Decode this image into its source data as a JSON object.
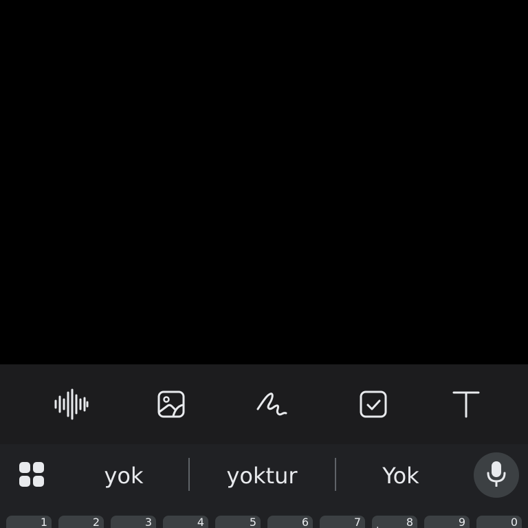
{
  "toolbar": {
    "tools": [
      {
        "name": "voice-recording-icon"
      },
      {
        "name": "image-icon"
      },
      {
        "name": "drawing-icon"
      },
      {
        "name": "checklist-icon"
      },
      {
        "name": "text-format-icon"
      }
    ]
  },
  "keyboard": {
    "suggestions": [
      "yok",
      "yoktur",
      "Yok"
    ],
    "apps_icon": "grid-apps-icon",
    "mic_icon": "microphone-icon",
    "number_keys": [
      "1",
      "2",
      "3",
      "4",
      "5",
      "6",
      "7",
      "8",
      "9",
      "0"
    ],
    "partial_key_mark": "."
  },
  "colors": {
    "background": "#000000",
    "toolbar_bg": "#1c1c1e",
    "keyboard_bg": "#202124",
    "key_bg": "#3c4043",
    "text": "#e8eaed"
  }
}
